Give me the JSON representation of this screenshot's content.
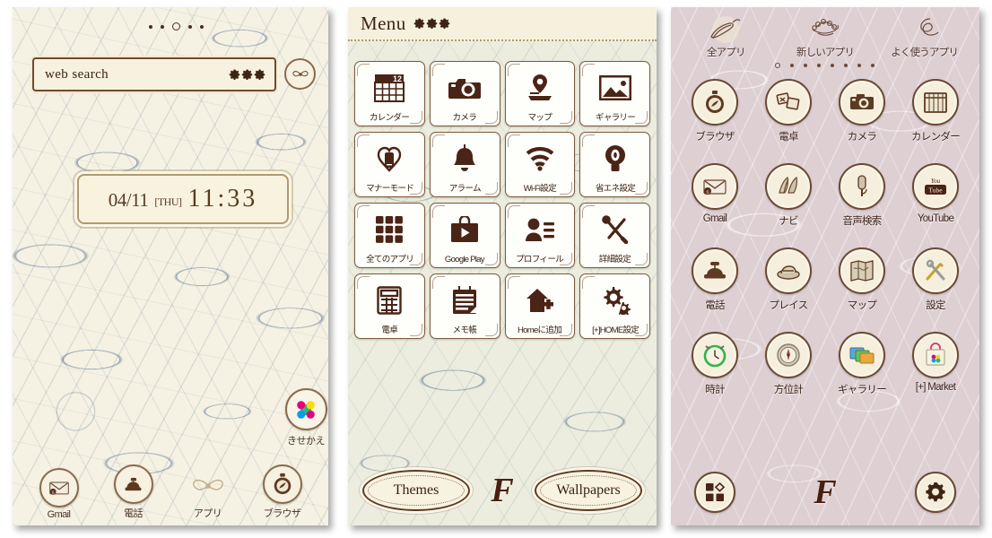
{
  "screens": [
    {
      "id": "home",
      "name": "Home Screen"
    },
    {
      "id": "menu",
      "name": "Menu Screen"
    },
    {
      "id": "drawer",
      "name": "App Drawer Screen"
    }
  ],
  "home": {
    "page_dots": {
      "count": 5,
      "active_index": 2
    },
    "search": {
      "text": "web search",
      "placeholder": "web search",
      "settings_icon": "gears-icon"
    },
    "bow_button": {
      "icon": "bow-icon"
    },
    "clock": {
      "date": "04/11",
      "day_of_week": "[THU]",
      "time": "11:33"
    },
    "kisekae": {
      "label": "きせかえ",
      "icon": "kisekae-icon"
    },
    "dock": [
      {
        "label": "Gmail",
        "icon": "gmail-icon"
      },
      {
        "label": "電話",
        "icon": "phone-icon"
      },
      {
        "label": "アプリ",
        "icon": "bow-apps-icon"
      },
      {
        "label": "ブラウザ",
        "icon": "browser-icon"
      }
    ]
  },
  "menu": {
    "title": "Menu",
    "settings_icon": "gears-icon",
    "tiles": [
      {
        "label": "カレンダー",
        "icon": "calendar-icon",
        "badge": "12"
      },
      {
        "label": "カメラ",
        "icon": "camera-icon"
      },
      {
        "label": "マップ",
        "icon": "map-pin-icon"
      },
      {
        "label": "ギャラリー",
        "icon": "gallery-icon"
      },
      {
        "label": "マナーモード",
        "icon": "manner-mode-icon"
      },
      {
        "label": "アラーム",
        "icon": "bell-icon"
      },
      {
        "label": "Wi-Fi設定",
        "icon": "wifi-icon"
      },
      {
        "label": "省エネ設定",
        "icon": "bulb-icon"
      },
      {
        "label": "全てのアプリ",
        "icon": "all-apps-icon"
      },
      {
        "label": "Google Play",
        "icon": "play-bag-icon"
      },
      {
        "label": "プロフィール",
        "icon": "profile-icon"
      },
      {
        "label": "詳細設定",
        "icon": "tools-icon"
      },
      {
        "label": "電卓",
        "icon": "calculator-icon"
      },
      {
        "label": "メモ帳",
        "icon": "notepad-icon"
      },
      {
        "label": "Homeに追加",
        "icon": "add-home-icon"
      },
      {
        "label": "[+]HOME設定",
        "icon": "gears-settings-icon"
      }
    ],
    "bottom": {
      "themes_label": "Themes",
      "wallpapers_label": "Wallpapers",
      "brand_mark": "F"
    }
  },
  "drawer": {
    "tabs": [
      {
        "label": "全アプリ",
        "icon": "ballet-shoes-icon"
      },
      {
        "label": "新しいアプリ",
        "icon": "flower-bow-icon"
      },
      {
        "label": "よく使うアプリ",
        "icon": "ribbon-icon"
      }
    ],
    "page_dots": {
      "count": 8,
      "active_index": 0
    },
    "apps": [
      {
        "label": "ブラウザ",
        "icon": "browser-icon"
      },
      {
        "label": "電卓",
        "icon": "calculator-icon"
      },
      {
        "label": "カメラ",
        "icon": "camera-icon"
      },
      {
        "label": "カレンダー",
        "icon": "calendar-icon"
      },
      {
        "label": "Gmail",
        "icon": "gmail-icon"
      },
      {
        "label": "ナビ",
        "icon": "navigation-icon"
      },
      {
        "label": "音声検索",
        "icon": "microphone-icon"
      },
      {
        "label": "YouTube",
        "icon": "youtube-icon"
      },
      {
        "label": "電話",
        "icon": "phone-icon"
      },
      {
        "label": "プレイス",
        "icon": "places-icon"
      },
      {
        "label": "マップ",
        "icon": "map-icon"
      },
      {
        "label": "設定",
        "icon": "settings-tools-icon"
      },
      {
        "label": "時計",
        "icon": "clock-icon"
      },
      {
        "label": "方位計",
        "icon": "compass-icon"
      },
      {
        "label": "ギャラリー",
        "icon": "gallery-icon"
      },
      {
        "label": "[+] Market",
        "icon": "market-bag-icon"
      }
    ],
    "dock": {
      "apps_grid_icon": "apps-grid-icon",
      "brand_mark": "F",
      "settings_icon": "gear-icon"
    }
  },
  "colors": {
    "home_bg": "#f5f2e3",
    "menu_bg": "#ecedde",
    "drawer_bg": "#decfd3",
    "pattern_blue": "#2e4c7a",
    "ink_brown": "#3d2419",
    "accent_brown": "#6b4a33",
    "cream": "#f7f2e0",
    "kisekae_magenta": "#e5007f",
    "kisekae_yellow": "#ffd900",
    "kisekae_cyan": "#00a0e9"
  }
}
